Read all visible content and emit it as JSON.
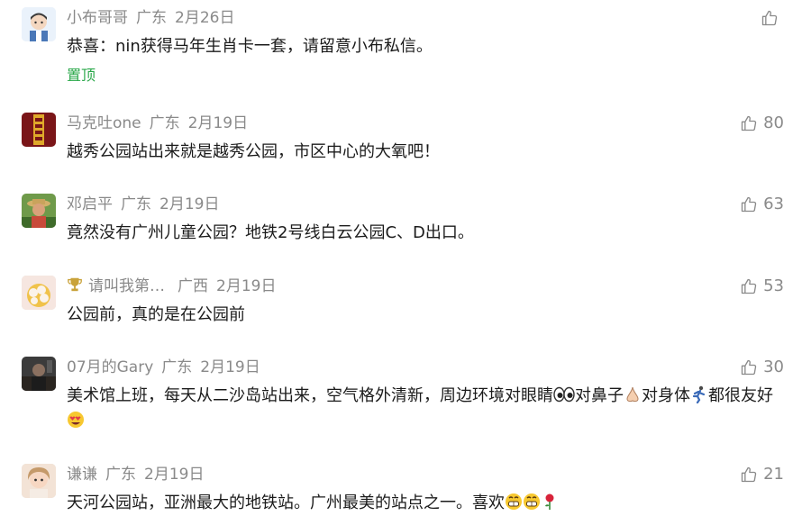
{
  "comments": [
    {
      "user": "小布哥哥",
      "location": "广东",
      "date": "2月26日",
      "text": "恭喜：nin获得马年生肖卡一套，请留意小布私信。",
      "pinned_label": "置顶",
      "likes": ""
    },
    {
      "user": "马克吐one",
      "location": "广东",
      "date": "2月19日",
      "text": "越秀公园站出来就是越秀公园，市区中心的大氧吧！",
      "likes": "80"
    },
    {
      "user": "邓启平",
      "location": "广东",
      "date": "2月19日",
      "text": "竟然没有广州儿童公园？地铁2号线白云公园C、D出口。",
      "likes": "63"
    },
    {
      "user": "请叫我第…",
      "location": "广西",
      "date": "2月19日",
      "text": "公园前，真的是在公园前",
      "likes": "53"
    },
    {
      "user": "07月的Gary",
      "location": "广东",
      "date": "2月19日",
      "text_parts": [
        "美术馆上班，每天从二沙岛站出来，空气格外清新，周边环境对眼睛",
        "对鼻子",
        "对身体",
        "都很友好"
      ],
      "likes": "30"
    },
    {
      "user": "谦谦",
      "location": "广东",
      "date": "2月19日",
      "text": "天河公园站，亚洲最大的地铁站。广州最美的站点之一。喜欢",
      "likes": "21"
    }
  ],
  "icons": {
    "like": "thumbs-up-icon",
    "badge": "trophy-icon",
    "emoji_eyes": "eyes-emoji",
    "emoji_nose": "nose-emoji",
    "emoji_runner": "running-person-emoji",
    "emoji_love": "heart-eyes-emoji",
    "emoji_grin": "grinning-face-emoji",
    "emoji_rose": "rose-emoji"
  },
  "colors": {
    "meta": "#8a8a8a",
    "pinned": "#2aa84a",
    "text": "#1b1b1b"
  }
}
